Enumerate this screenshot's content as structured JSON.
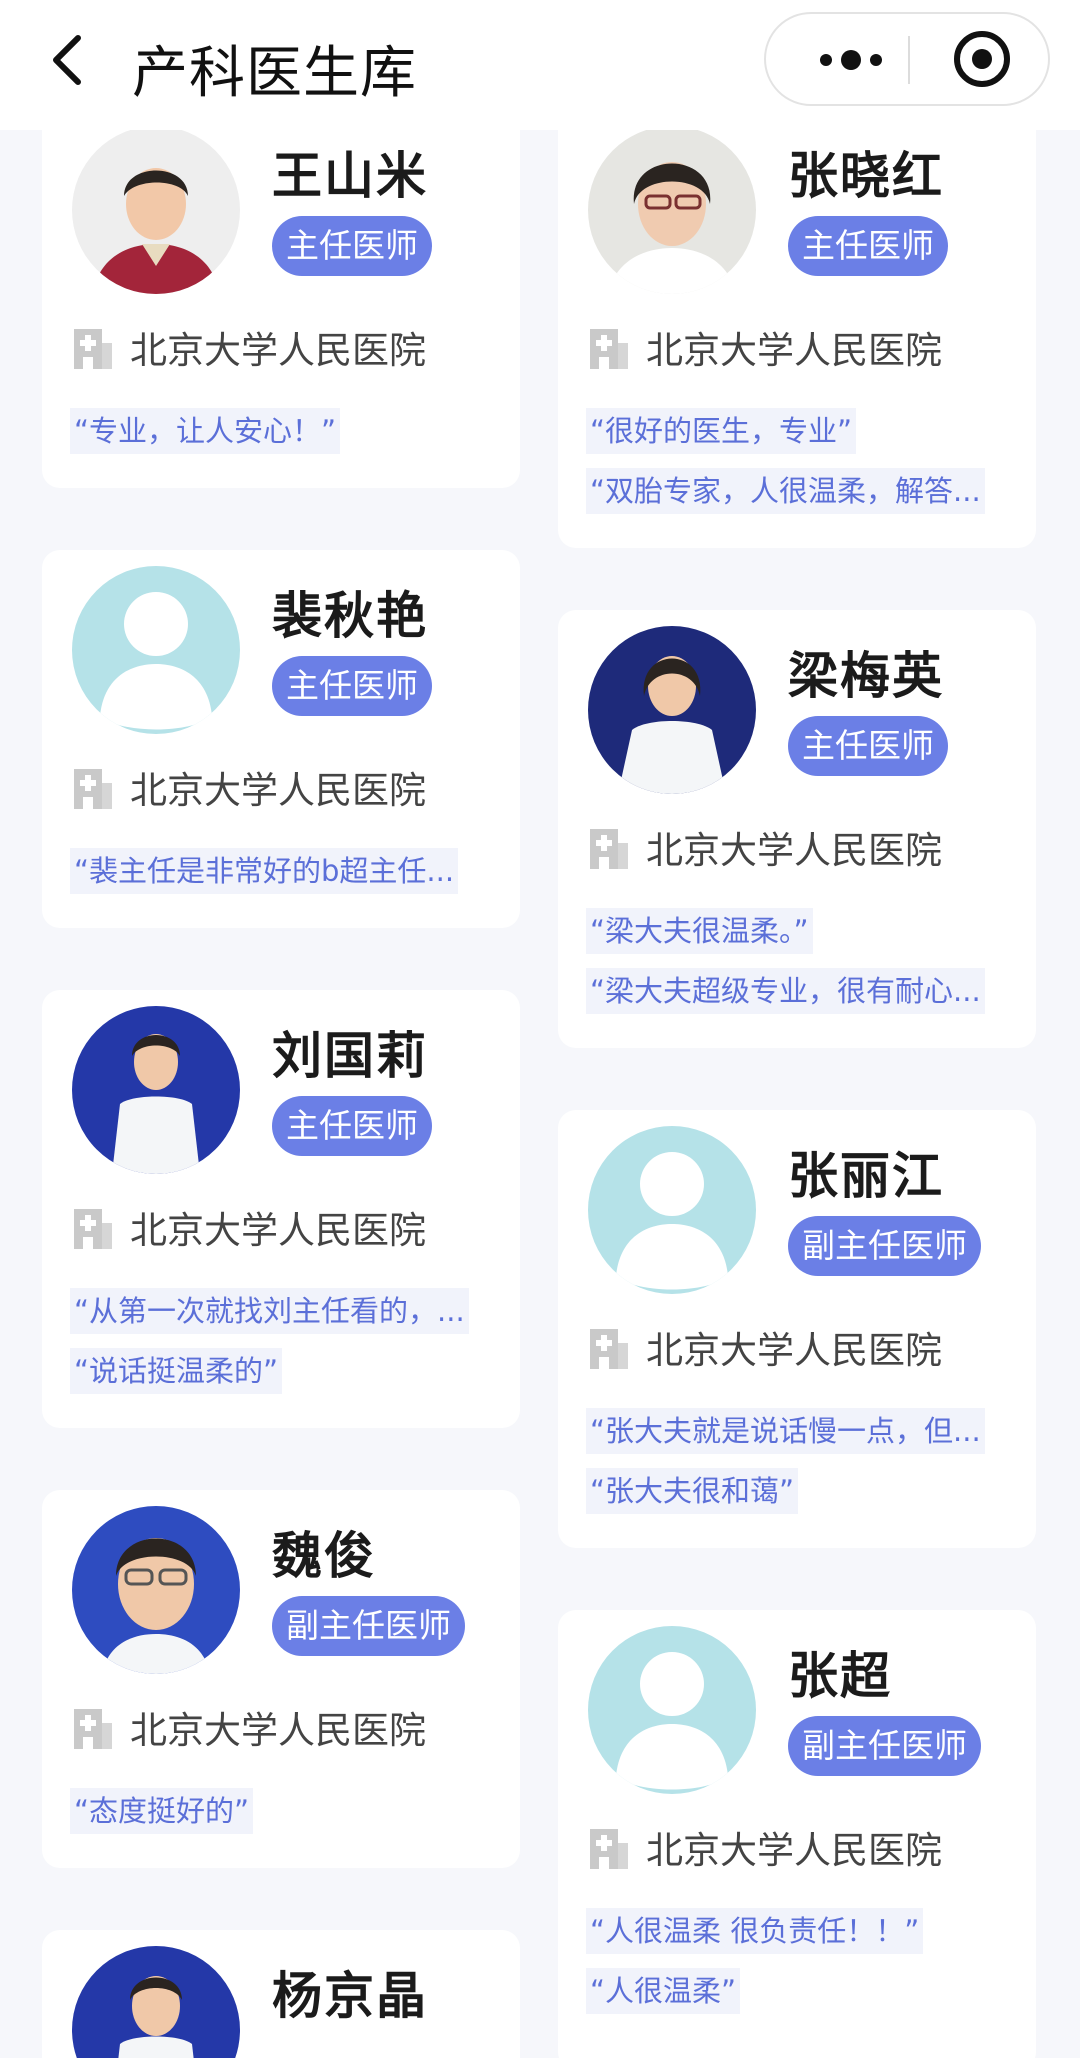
{
  "nav": {
    "title": "产科医生库"
  },
  "icons": {
    "back": "chevron-left-icon",
    "more": "more-dots-icon",
    "close": "target-icon",
    "hospital": "hospital-building-icon"
  },
  "colors": {
    "badge": "#6b7fe6",
    "review_text": "#5b6fd8",
    "placeholder_avatar": "#b5e2e8"
  },
  "left": [
    {
      "name": "王山米",
      "title": "主任医师",
      "hospital": "北京大学人民医院",
      "reviews": [
        "“专业，让人安心！”"
      ]
    },
    {
      "name": "裴秋艳",
      "title": "主任医师",
      "hospital": "北京大学人民医院",
      "reviews": [
        "“裴主任是非常好的b超主任..."
      ]
    },
    {
      "name": "刘国莉",
      "title": "主任医师",
      "hospital": "北京大学人民医院",
      "reviews": [
        "“从第一次就找刘主任看的，...",
        "“说话挺温柔的”"
      ]
    },
    {
      "name": "魏俊",
      "title": "副主任医师",
      "hospital": "北京大学人民医院",
      "reviews": [
        "“态度挺好的”"
      ]
    },
    {
      "name": "杨京晶",
      "title": "",
      "hospital": "",
      "reviews": []
    }
  ],
  "right": [
    {
      "name": "张晓红",
      "title": "主任医师",
      "hospital": "北京大学人民医院",
      "reviews": [
        "“很好的医生，专业”",
        "“双胎专家，人很温柔，解答..."
      ]
    },
    {
      "name": "梁梅英",
      "title": "主任医师",
      "hospital": "北京大学人民医院",
      "reviews": [
        "“梁大夫很温柔。”",
        "“梁大夫超级专业，很有耐心..."
      ]
    },
    {
      "name": "张丽江",
      "title": "副主任医师",
      "hospital": "北京大学人民医院",
      "reviews": [
        "“张大夫就是说话慢一点，但...",
        "“张大夫很和蔼”"
      ]
    },
    {
      "name": "张超",
      "title": "副主任医师",
      "hospital": "北京大学人民医院",
      "reviews": [
        "“人很温柔 很负责任！！”",
        "“人很温柔”"
      ]
    }
  ]
}
